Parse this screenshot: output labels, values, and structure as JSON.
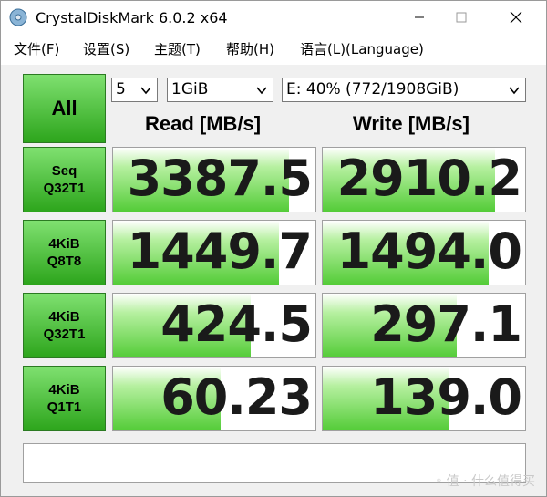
{
  "window": {
    "title": "CrystalDiskMark 6.0.2 x64"
  },
  "menu": [
    "文件(F)",
    "设置(S)",
    "主题(T)",
    "帮助(H)",
    "语言(L)(Language)"
  ],
  "controls": {
    "all_label": "All",
    "count": "5",
    "size": "1GiB",
    "drive": "E: 40% (772/1908GiB)"
  },
  "headers": {
    "read": "Read [MB/s]",
    "write": "Write [MB/s]"
  },
  "tests": [
    {
      "line1": "Seq",
      "line2": "Q32T1",
      "read": "3387.5",
      "write": "2910.2",
      "read_fill": 0.87,
      "write_fill": 0.85
    },
    {
      "line1": "4KiB",
      "line2": "Q8T8",
      "read": "1449.7",
      "write": "1494.0",
      "read_fill": 0.82,
      "write_fill": 0.82
    },
    {
      "line1": "4KiB",
      "line2": "Q32T1",
      "read": "424.5",
      "write": "297.1",
      "read_fill": 0.68,
      "write_fill": 0.66
    },
    {
      "line1": "4KiB",
      "line2": "Q1T1",
      "read": "60.23",
      "write": "139.0",
      "read_fill": 0.53,
      "write_fill": 0.62
    }
  ],
  "comment": "",
  "watermark": "值 · 什么值得买",
  "colors": {
    "accent_green": "#2da51c",
    "bar_green": "#54cc38"
  }
}
